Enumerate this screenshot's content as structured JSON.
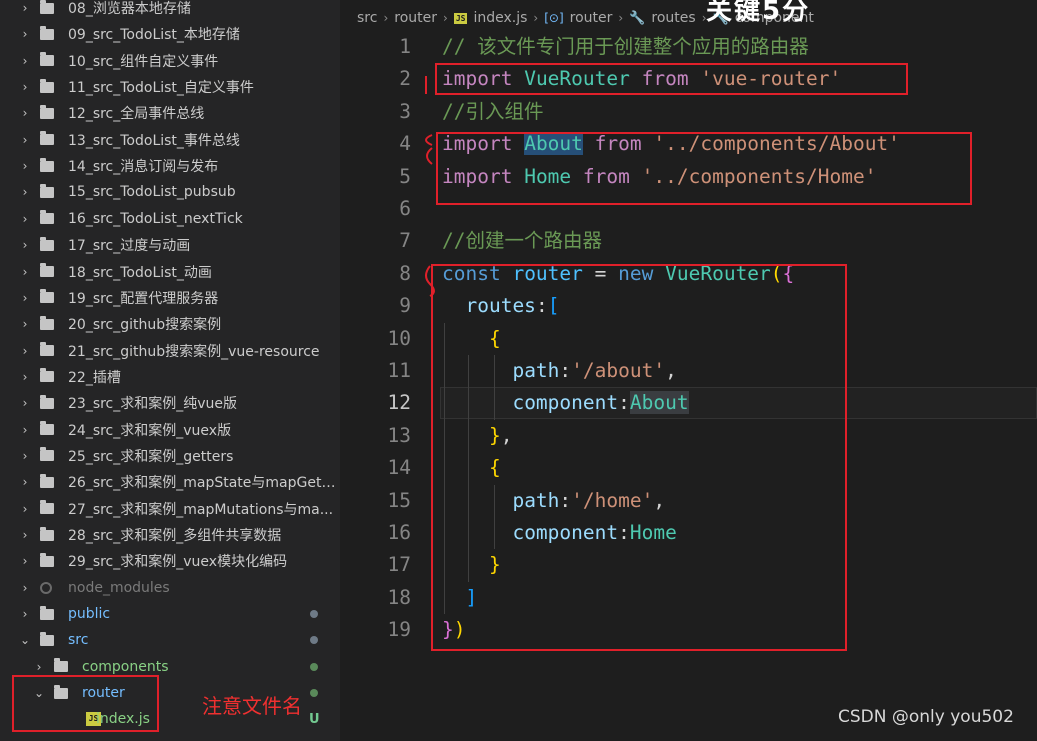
{
  "sidebar": {
    "items": [
      {
        "label": "08_浏览器本地存储",
        "chevron": "›",
        "style": "normal"
      },
      {
        "label": "09_src_TodoList_本地存储",
        "chevron": "›",
        "style": "normal"
      },
      {
        "label": "10_src_组件自定义事件",
        "chevron": "›",
        "style": "normal"
      },
      {
        "label": "11_src_TodoList_自定义事件",
        "chevron": "›",
        "style": "normal"
      },
      {
        "label": "12_src_全局事件总线",
        "chevron": "›",
        "style": "normal"
      },
      {
        "label": "13_src_TodoList_事件总线",
        "chevron": "›",
        "style": "normal"
      },
      {
        "label": "14_src_消息订阅与发布",
        "chevron": "›",
        "style": "normal"
      },
      {
        "label": "15_src_TodoList_pubsub",
        "chevron": "›",
        "style": "normal"
      },
      {
        "label": "16_src_TodoList_nextTick",
        "chevron": "›",
        "style": "normal"
      },
      {
        "label": "17_src_过度与动画",
        "chevron": "›",
        "style": "normal"
      },
      {
        "label": "18_src_TodoList_动画",
        "chevron": "›",
        "style": "normal"
      },
      {
        "label": "19_src_配置代理服务器",
        "chevron": "›",
        "style": "normal"
      },
      {
        "label": "20_src_github搜索案例",
        "chevron": "›",
        "style": "normal"
      },
      {
        "label": "21_src_github搜索案例_vue-resource",
        "chevron": "›",
        "style": "normal"
      },
      {
        "label": "22_插槽",
        "chevron": "›",
        "style": "normal"
      },
      {
        "label": "23_src_求和案例_纯vue版",
        "chevron": "›",
        "style": "normal"
      },
      {
        "label": "24_src_求和案例_vuex版",
        "chevron": "›",
        "style": "normal"
      },
      {
        "label": "25_src_求和案例_getters",
        "chevron": "›",
        "style": "normal"
      },
      {
        "label": "26_src_求和案例_mapState与mapGett...",
        "chevron": "›",
        "style": "normal"
      },
      {
        "label": "27_src_求和案例_mapMutations与ma...",
        "chevron": "›",
        "style": "normal"
      },
      {
        "label": "28_src_求和案例_多组件共享数据",
        "chevron": "›",
        "style": "normal"
      },
      {
        "label": "29_src_求和案例_vuex模块化编码",
        "chevron": "›",
        "style": "normal"
      },
      {
        "label": "node_modules",
        "chevron": "›",
        "style": "gray"
      },
      {
        "label": "public",
        "chevron": "›",
        "style": "blue"
      },
      {
        "label": "src",
        "chevron": "⌄",
        "style": "blue"
      },
      {
        "label": "components",
        "chevron": "›",
        "style": "green"
      },
      {
        "label": "router",
        "chevron": "⌄",
        "style": "blue"
      },
      {
        "label": "index.js",
        "chevron": "",
        "style": "green"
      }
    ],
    "file_icon_text": "JS",
    "untracked_badge": "U",
    "annotation_note": "注意文件名"
  },
  "breadcrumb": {
    "items": [
      "src",
      "router",
      "index.js",
      "router",
      "routes",
      "component"
    ],
    "js_icon": "JS",
    "overlay_caption": "关键5分"
  },
  "editor": {
    "lines": [
      {
        "n": "1",
        "tokens": [
          [
            "cmt",
            "// 该文件专门用于创建整个应用的路由器"
          ]
        ]
      },
      {
        "n": "2",
        "tokens": [
          [
            "kw",
            "import"
          ],
          [
            "pun",
            " "
          ],
          [
            "cls",
            "VueRouter"
          ],
          [
            "pun",
            " "
          ],
          [
            "kw",
            "from"
          ],
          [
            "pun",
            " "
          ],
          [
            "str",
            "'vue-router'"
          ]
        ]
      },
      {
        "n": "3",
        "tokens": [
          [
            "cmt",
            "//引入组件"
          ]
        ]
      },
      {
        "n": "4",
        "tokens": [
          [
            "kw",
            "import"
          ],
          [
            "pun",
            " "
          ],
          [
            "cls sel-about",
            "About"
          ],
          [
            "pun",
            " "
          ],
          [
            "kw",
            "from"
          ],
          [
            "pun",
            " "
          ],
          [
            "str",
            "'../components/About'"
          ]
        ]
      },
      {
        "n": "5",
        "tokens": [
          [
            "kw",
            "import"
          ],
          [
            "pun",
            " "
          ],
          [
            "cls",
            "Home"
          ],
          [
            "pun",
            " "
          ],
          [
            "kw",
            "from"
          ],
          [
            "pun",
            " "
          ],
          [
            "str",
            "'../components/Home'"
          ]
        ]
      },
      {
        "n": "6",
        "tokens": []
      },
      {
        "n": "7",
        "tokens": [
          [
            "cmt",
            "//创建一个路由器"
          ]
        ]
      },
      {
        "n": "8",
        "tokens": [
          [
            "kw2",
            "const"
          ],
          [
            "pun",
            " "
          ],
          [
            "var",
            "router"
          ],
          [
            "pun",
            " = "
          ],
          [
            "kw2",
            "new"
          ],
          [
            "pun",
            " "
          ],
          [
            "cls",
            "VueRouter"
          ],
          [
            "brk",
            "("
          ],
          [
            "brk2",
            "{"
          ]
        ]
      },
      {
        "n": "9",
        "tokens": [
          [
            "pun",
            "  "
          ],
          [
            "prop",
            "routes"
          ],
          [
            "pun",
            ":"
          ],
          [
            "brk3",
            "["
          ]
        ]
      },
      {
        "n": "10",
        "tokens": [
          [
            "pun",
            "    "
          ],
          [
            "brk",
            "{"
          ]
        ]
      },
      {
        "n": "11",
        "tokens": [
          [
            "pun",
            "      "
          ],
          [
            "prop",
            "path"
          ],
          [
            "pun",
            ":"
          ],
          [
            "str",
            "'/about'"
          ],
          [
            "pun",
            ","
          ]
        ]
      },
      {
        "n": "12",
        "tokens": [
          [
            "pun",
            "      "
          ],
          [
            "prop",
            "component"
          ],
          [
            "pun",
            ":"
          ],
          [
            "cls word-hl",
            "About"
          ]
        ]
      },
      {
        "n": "13",
        "tokens": [
          [
            "pun",
            "    "
          ],
          [
            "brk",
            "}"
          ],
          [
            "pun",
            ","
          ]
        ]
      },
      {
        "n": "14",
        "tokens": [
          [
            "pun",
            "    "
          ],
          [
            "brk",
            "{"
          ]
        ]
      },
      {
        "n": "15",
        "tokens": [
          [
            "pun",
            "      "
          ],
          [
            "prop",
            "path"
          ],
          [
            "pun",
            ":"
          ],
          [
            "str",
            "'/home'"
          ],
          [
            "pun",
            ","
          ]
        ]
      },
      {
        "n": "16",
        "tokens": [
          [
            "pun",
            "      "
          ],
          [
            "prop",
            "component"
          ],
          [
            "pun",
            ":"
          ],
          [
            "cls",
            "Home"
          ]
        ]
      },
      {
        "n": "17",
        "tokens": [
          [
            "pun",
            "    "
          ],
          [
            "brk",
            "}"
          ]
        ]
      },
      {
        "n": "18",
        "tokens": [
          [
            "pun",
            "  "
          ],
          [
            "brk3",
            "]"
          ]
        ]
      },
      {
        "n": "19",
        "tokens": [
          [
            "brk2",
            "}"
          ],
          [
            "brk",
            ")"
          ]
        ]
      }
    ],
    "active_line": "12"
  },
  "watermark": "CSDN @only you502",
  "colors": {
    "annotation_red": "#e0202a",
    "editor_bg": "#1e1e1e",
    "sidebar_bg": "#252526"
  }
}
